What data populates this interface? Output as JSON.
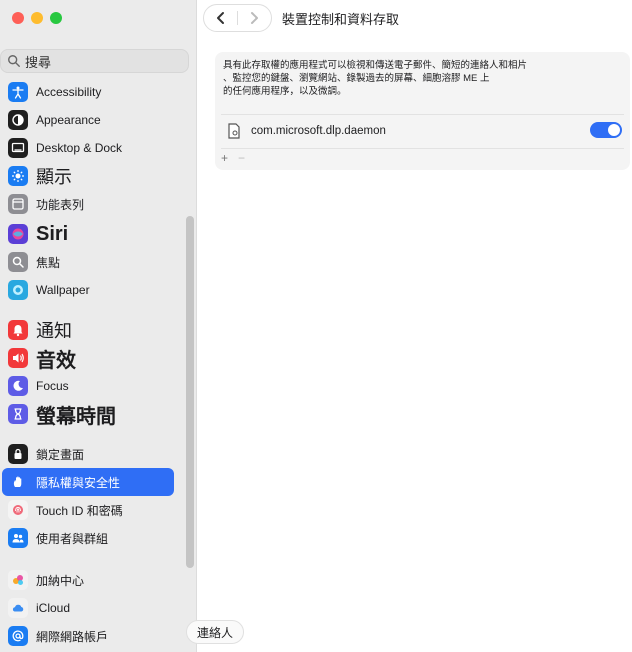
{
  "window": {
    "controls": [
      "close",
      "minimize",
      "zoom"
    ]
  },
  "search": {
    "text": "搜尋",
    "icon": "search-icon"
  },
  "sidebar": {
    "items": [
      {
        "label": "Accessibility",
        "icon": "accessibility-icon",
        "color": "#1a7cf2",
        "size": "normal"
      },
      {
        "label": "Appearance",
        "icon": "appearance-icon",
        "color": "#1f1f1f",
        "size": "normal"
      },
      {
        "label": "Desktop & Dock",
        "icon": "desktop-dock-icon",
        "color": "#1f1f1f",
        "size": "normal"
      },
      {
        "label": "顯示",
        "icon": "display-icon",
        "color": "#1a7cf2",
        "size": "big"
      },
      {
        "label": "功能表列",
        "icon": "menu-bar-icon",
        "color": "#8e8e93",
        "size": "normal"
      },
      {
        "label": "Siri",
        "icon": "siri-icon",
        "color": "#5b3fd6",
        "size": "bigger"
      },
      {
        "label": "焦點",
        "icon": "spotlight-icon",
        "color": "#8e8e93",
        "size": "normal"
      },
      {
        "label": "Wallpaper",
        "icon": "wallpaper-icon",
        "color": "#29a8e0",
        "size": "normal"
      },
      {
        "label": "通知",
        "icon": "notifications-icon",
        "color": "#f2383a",
        "size": "big"
      },
      {
        "label": "音效",
        "icon": "sound-icon",
        "color": "#f2383a",
        "size": "bigger"
      },
      {
        "label": "Focus",
        "icon": "focus-icon",
        "color": "#5e5ce6",
        "size": "normal"
      },
      {
        "label": "螢幕時間",
        "icon": "screen-time-icon",
        "color": "#5e5ce6",
        "size": "bigger"
      },
      {
        "label": "鎖定畫面",
        "icon": "lock-screen-icon",
        "color": "#1f1f1f",
        "size": "normal"
      },
      {
        "label": "隱私權與安全性",
        "icon": "privacy-hand-icon",
        "color": "#2f6ef5",
        "size": "normal",
        "selected": true
      },
      {
        "label": "Touch ID 和密碼",
        "icon": "touch-id-icon",
        "color": "#f4f4f4",
        "size": "normal"
      },
      {
        "label": "使用者與群組",
        "icon": "users-groups-icon",
        "color": "#1a7cf2",
        "size": "normal"
      },
      {
        "label": "加納中心",
        "icon": "game-center-icon",
        "color": "#f2f2f2",
        "size": "normal"
      },
      {
        "label": "iCloud",
        "icon": "icloud-icon",
        "color": "#f2f2f2",
        "size": "normal"
      },
      {
        "label": "網際網路帳戶",
        "icon": "internet-accounts-icon",
        "color": "#1a7cf2",
        "size": "normal"
      }
    ]
  },
  "header": {
    "back_icon": "chevron-left-icon",
    "forward_icon": "chevron-right-icon",
    "title": "裝置控制和資料存取"
  },
  "panel": {
    "description_line1": "具有此存取權的應用程式可以檢視和傳送電子郵件、簡短的連絡人和相片",
    "description_line2": "、監控您的鍵盤、瀏覽網站、錄製過去的屏幕、細胞溶膠 ME 上",
    "description_line3": "的任何應用程序，以及微調。",
    "app": {
      "name": "com.microsoft.dlp.daemon",
      "enabled": true,
      "icon": "file-document-icon"
    },
    "add_label": "+",
    "remove_label": "−"
  },
  "tooltip": {
    "text": "連絡人"
  },
  "colors": {
    "accent": "#2f6ef5",
    "sidebar_bg": "#ebebeb",
    "panel_bg": "#f4f4f4"
  }
}
